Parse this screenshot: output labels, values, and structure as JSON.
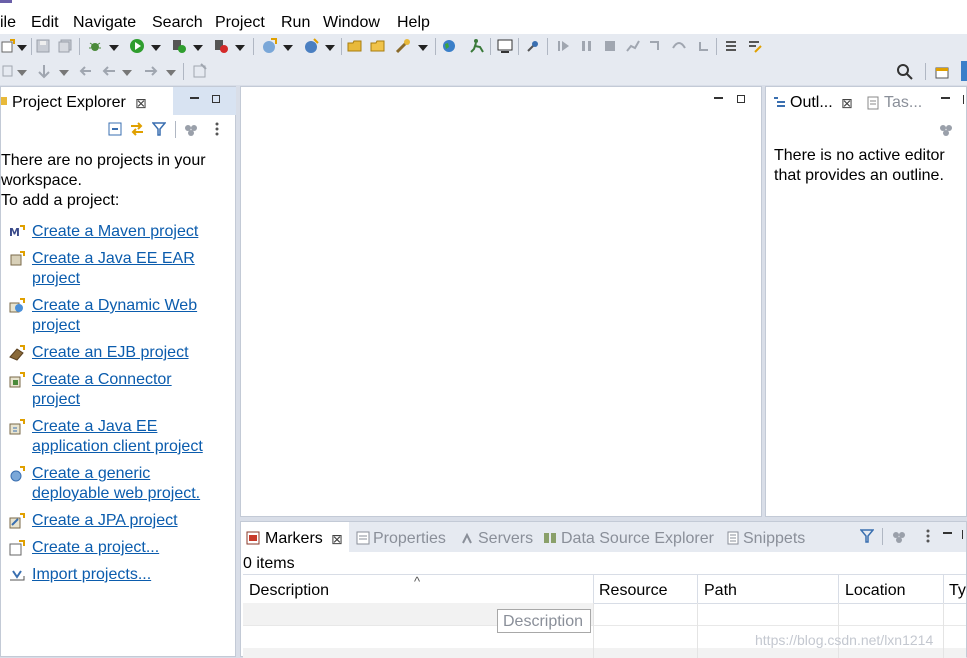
{
  "menu": [
    "ile",
    "Edit",
    "Navigate",
    "Search",
    "Project",
    "Run",
    "Window",
    "Help"
  ],
  "project_explorer": {
    "tab_label": "Project Explorer",
    "close_glyph": "⊠",
    "message_line1": "There are no projects in your",
    "message_line2": "workspace.",
    "message_line3": "To add a project:",
    "links": [
      {
        "line1": "Create a Maven project",
        "line2": "",
        "icon": "maven-icon"
      },
      {
        "line1": "Create a Java EE EAR ",
        "line2": "project",
        "icon": "ear-project-icon"
      },
      {
        "line1": "Create a Dynamic Web ",
        "line2": "project",
        "icon": "web-project-icon"
      },
      {
        "line1": "Create an EJB project",
        "line2": "",
        "icon": "ejb-project-icon"
      },
      {
        "line1": "Create a Connector ",
        "line2": "project",
        "icon": "connector-project-icon"
      },
      {
        "line1": "Create a Java EE ",
        "line2": "application client project",
        "icon": "app-client-icon"
      },
      {
        "line1": "Create a generic ",
        "line2": "deployable web project.",
        "icon": "generic-web-icon"
      },
      {
        "line1": "Create a JPA project",
        "line2": "",
        "icon": "jpa-project-icon"
      },
      {
        "line1": "Create a project...",
        "line2": "",
        "icon": "new-project-icon"
      },
      {
        "line1": "Import projects...",
        "line2": "",
        "icon": "import-icon"
      }
    ]
  },
  "outline": {
    "tab_outline": "Outl...",
    "tab_tasks": "Tas...",
    "close_glyph": "⊠",
    "message_line1": "There is no active editor",
    "message_line2": "that provides an outline."
  },
  "bottom": {
    "tabs": [
      {
        "label": "Markers",
        "active": true
      },
      {
        "label": "Properties",
        "active": false
      },
      {
        "label": "Servers",
        "active": false
      },
      {
        "label": "Data Source Explorer",
        "active": false
      },
      {
        "label": "Snippets",
        "active": false
      }
    ],
    "close_glyph": "⊠",
    "items_count": "0 items",
    "sort_glyph": "^",
    "columns": [
      "Description",
      "Resource",
      "Path",
      "Location",
      "Ty"
    ],
    "tooltip": "Description"
  },
  "watermark": "https://blog.csdn.net/lxn1214",
  "colors": {
    "link": "#0b5cad",
    "chrome": "#e6eaf1",
    "panel_border": "#c3cad6"
  }
}
